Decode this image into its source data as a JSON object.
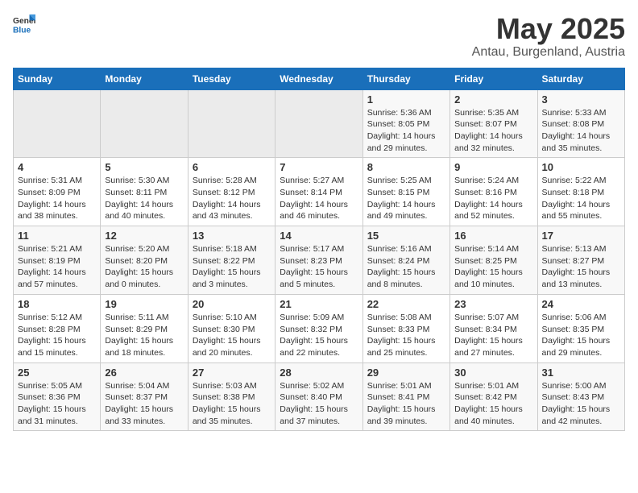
{
  "header": {
    "logo_general": "General",
    "logo_blue": "Blue",
    "title": "May 2025",
    "location": "Antau, Burgenland, Austria"
  },
  "weekdays": [
    "Sunday",
    "Monday",
    "Tuesday",
    "Wednesday",
    "Thursday",
    "Friday",
    "Saturday"
  ],
  "weeks": [
    [
      {
        "day": "",
        "info": ""
      },
      {
        "day": "",
        "info": ""
      },
      {
        "day": "",
        "info": ""
      },
      {
        "day": "",
        "info": ""
      },
      {
        "day": "1",
        "info": "Sunrise: 5:36 AM\nSunset: 8:05 PM\nDaylight: 14 hours\nand 29 minutes."
      },
      {
        "day": "2",
        "info": "Sunrise: 5:35 AM\nSunset: 8:07 PM\nDaylight: 14 hours\nand 32 minutes."
      },
      {
        "day": "3",
        "info": "Sunrise: 5:33 AM\nSunset: 8:08 PM\nDaylight: 14 hours\nand 35 minutes."
      }
    ],
    [
      {
        "day": "4",
        "info": "Sunrise: 5:31 AM\nSunset: 8:09 PM\nDaylight: 14 hours\nand 38 minutes."
      },
      {
        "day": "5",
        "info": "Sunrise: 5:30 AM\nSunset: 8:11 PM\nDaylight: 14 hours\nand 40 minutes."
      },
      {
        "day": "6",
        "info": "Sunrise: 5:28 AM\nSunset: 8:12 PM\nDaylight: 14 hours\nand 43 minutes."
      },
      {
        "day": "7",
        "info": "Sunrise: 5:27 AM\nSunset: 8:14 PM\nDaylight: 14 hours\nand 46 minutes."
      },
      {
        "day": "8",
        "info": "Sunrise: 5:25 AM\nSunset: 8:15 PM\nDaylight: 14 hours\nand 49 minutes."
      },
      {
        "day": "9",
        "info": "Sunrise: 5:24 AM\nSunset: 8:16 PM\nDaylight: 14 hours\nand 52 minutes."
      },
      {
        "day": "10",
        "info": "Sunrise: 5:22 AM\nSunset: 8:18 PM\nDaylight: 14 hours\nand 55 minutes."
      }
    ],
    [
      {
        "day": "11",
        "info": "Sunrise: 5:21 AM\nSunset: 8:19 PM\nDaylight: 14 hours\nand 57 minutes."
      },
      {
        "day": "12",
        "info": "Sunrise: 5:20 AM\nSunset: 8:20 PM\nDaylight: 15 hours\nand 0 minutes."
      },
      {
        "day": "13",
        "info": "Sunrise: 5:18 AM\nSunset: 8:22 PM\nDaylight: 15 hours\nand 3 minutes."
      },
      {
        "day": "14",
        "info": "Sunrise: 5:17 AM\nSunset: 8:23 PM\nDaylight: 15 hours\nand 5 minutes."
      },
      {
        "day": "15",
        "info": "Sunrise: 5:16 AM\nSunset: 8:24 PM\nDaylight: 15 hours\nand 8 minutes."
      },
      {
        "day": "16",
        "info": "Sunrise: 5:14 AM\nSunset: 8:25 PM\nDaylight: 15 hours\nand 10 minutes."
      },
      {
        "day": "17",
        "info": "Sunrise: 5:13 AM\nSunset: 8:27 PM\nDaylight: 15 hours\nand 13 minutes."
      }
    ],
    [
      {
        "day": "18",
        "info": "Sunrise: 5:12 AM\nSunset: 8:28 PM\nDaylight: 15 hours\nand 15 minutes."
      },
      {
        "day": "19",
        "info": "Sunrise: 5:11 AM\nSunset: 8:29 PM\nDaylight: 15 hours\nand 18 minutes."
      },
      {
        "day": "20",
        "info": "Sunrise: 5:10 AM\nSunset: 8:30 PM\nDaylight: 15 hours\nand 20 minutes."
      },
      {
        "day": "21",
        "info": "Sunrise: 5:09 AM\nSunset: 8:32 PM\nDaylight: 15 hours\nand 22 minutes."
      },
      {
        "day": "22",
        "info": "Sunrise: 5:08 AM\nSunset: 8:33 PM\nDaylight: 15 hours\nand 25 minutes."
      },
      {
        "day": "23",
        "info": "Sunrise: 5:07 AM\nSunset: 8:34 PM\nDaylight: 15 hours\nand 27 minutes."
      },
      {
        "day": "24",
        "info": "Sunrise: 5:06 AM\nSunset: 8:35 PM\nDaylight: 15 hours\nand 29 minutes."
      }
    ],
    [
      {
        "day": "25",
        "info": "Sunrise: 5:05 AM\nSunset: 8:36 PM\nDaylight: 15 hours\nand 31 minutes."
      },
      {
        "day": "26",
        "info": "Sunrise: 5:04 AM\nSunset: 8:37 PM\nDaylight: 15 hours\nand 33 minutes."
      },
      {
        "day": "27",
        "info": "Sunrise: 5:03 AM\nSunset: 8:38 PM\nDaylight: 15 hours\nand 35 minutes."
      },
      {
        "day": "28",
        "info": "Sunrise: 5:02 AM\nSunset: 8:40 PM\nDaylight: 15 hours\nand 37 minutes."
      },
      {
        "day": "29",
        "info": "Sunrise: 5:01 AM\nSunset: 8:41 PM\nDaylight: 15 hours\nand 39 minutes."
      },
      {
        "day": "30",
        "info": "Sunrise: 5:01 AM\nSunset: 8:42 PM\nDaylight: 15 hours\nand 40 minutes."
      },
      {
        "day": "31",
        "info": "Sunrise: 5:00 AM\nSunset: 8:43 PM\nDaylight: 15 hours\nand 42 minutes."
      }
    ]
  ]
}
